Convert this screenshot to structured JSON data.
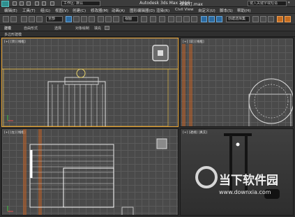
{
  "titlebar": {
    "workspace": "工作区: 默认",
    "app_title": "Autodesk 3ds Max 2016",
    "file_title": "探索灯.max",
    "search_placeholder": "键入关键字或短语"
  },
  "menubar": {
    "items": [
      "编辑(E)",
      "工具(T)",
      "组(G)",
      "视图(V)",
      "创建(C)",
      "修改器(M)",
      "动画(A)",
      "图形编辑器(D)",
      "渲染(R)",
      "Civil View",
      "自定义(U)",
      "脚本(S)",
      "帮助(H)"
    ]
  },
  "toolbar": {
    "selection_filter": "全部",
    "view_dropdown": "视图",
    "named_selection": "创建选择集"
  },
  "ribbon": {
    "tabs": [
      "建模",
      "自由形式",
      "选择",
      "对象绘制",
      "填充"
    ]
  },
  "subribbon": {
    "label": "多边形建模"
  },
  "viewports": {
    "top_left_label": "[+] [顶] [线框]",
    "top_right_label": "[+] [前] [线框]",
    "bottom_left_label": "[+] [左] [线框]",
    "bottom_right_label": "[+] [透视] [真实]"
  },
  "watermark": {
    "brand": "当下软件园",
    "url": "www.downxia.com"
  },
  "icons": [
    "app-logo-icon",
    "undo-icon",
    "redo-icon",
    "select-icon",
    "move-icon",
    "rotate-icon",
    "scale-icon",
    "snap-icon",
    "render-icon",
    "viewcube-icon"
  ]
}
